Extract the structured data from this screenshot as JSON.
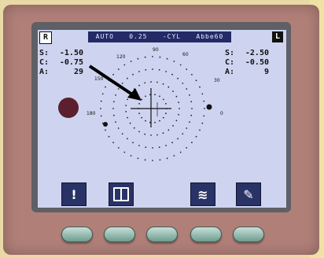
{
  "header": {
    "mode": "AUTO",
    "step": "0.25",
    "cyl_sign": "-CYL",
    "abbe": "Abbe60"
  },
  "right_eye": {
    "badge": "R",
    "S_label": "S:",
    "S": "-1.50",
    "C_label": "C:",
    "C": "-0.75",
    "A_label": "A:",
    "A": "29"
  },
  "left_eye": {
    "badge": "L",
    "S_label": "S:",
    "S": "-2.50",
    "C_label": "C:",
    "C": "-0.50",
    "A_label": "A:",
    "A": "9"
  },
  "dial": {
    "labels": [
      "60",
      "90",
      "120",
      "150",
      "180",
      "30",
      "0"
    ]
  },
  "softkeys": [
    {
      "name": "alert",
      "glyph": "!"
    },
    {
      "name": "book",
      "glyph": "📖"
    },
    {
      "name": "scan",
      "glyph": "≋"
    },
    {
      "name": "eraser",
      "glyph": "✎"
    }
  ],
  "colors": {
    "screen_bg": "#ced4f0",
    "header_bg": "#232a66",
    "bezel": "#b07f78",
    "button": "#8fbcb0"
  }
}
